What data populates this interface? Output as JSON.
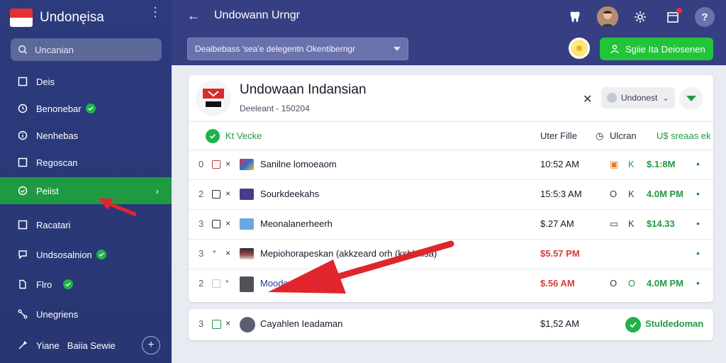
{
  "app": {
    "title": "Undonęisa"
  },
  "sidebar": {
    "search_placeholder": "Uncanian",
    "items": [
      {
        "label": "Deis",
        "icon": "square-icon",
        "badge": false
      },
      {
        "label": "Benonebar",
        "icon": "clock-icon",
        "badge": true
      },
      {
        "label": "Nenhebas",
        "icon": "info-icon",
        "badge": false
      },
      {
        "label": "Regoscan",
        "icon": "square-icon",
        "badge": false
      },
      {
        "label": "Peiist",
        "icon": "clock-icon",
        "badge": false,
        "active": true
      },
      {
        "label": "Racatari",
        "icon": "square-icon",
        "badge": false
      },
      {
        "label": "Undsosalnion",
        "icon": "chat-icon",
        "badge": true
      },
      {
        "label": "Flro",
        "icon": "file-icon",
        "badge": true
      },
      {
        "label": "Unegriens",
        "icon": "branch-icon",
        "badge": false
      },
      {
        "label": "Yiane",
        "label_suffix": "Baiia Sewie",
        "icon": "tool-icon",
        "badge": false
      }
    ]
  },
  "topbar": {
    "title": "Undowann Urngr",
    "filter_label": "Deaibebass 'sea'e delegentn Okentiberngr",
    "primary_button": "Sgiie Ita Deiosenen"
  },
  "card": {
    "title": "Undowaan Indansian",
    "subtitle": "Deeleant - 150204",
    "select_value": "Undonest",
    "header": {
      "label": "Kt Vecke",
      "col_file": "Uter Fille",
      "col_status": "Ulcran",
      "col_amount": "U$ sreaas ek"
    },
    "rows": [
      {
        "num": "0",
        "name": "Sanilne lomoeaom",
        "time": "10:52 AM",
        "time_alert": false,
        "a1": "lock-icon",
        "a2": "K",
        "amount": "$.1:8M",
        "thumb_color": "#3a5ba8"
      },
      {
        "num": "2",
        "name": "Sourkdeekahs",
        "time": "15:5:3 AM",
        "time_alert": false,
        "a1": "O",
        "a2": "K",
        "amount": "4.0M PM",
        "thumb_color": "#4a3a8c"
      },
      {
        "num": "3",
        "name": "Meonalanerheerh",
        "time": "$.27 AM",
        "time_alert": false,
        "a1": "calendar-icon",
        "a2": "K",
        "amount": "$14.33",
        "thumb_color": "#6aa7e0"
      },
      {
        "num": "3",
        "name": "Mepiohorapeskan (akkzeard orh (kshlmisa)",
        "time": "$5.57 PM",
        "time_alert": true,
        "a1": "",
        "a2": "",
        "amount": "",
        "thumb_color": "#6a3f3f"
      },
      {
        "num": "2",
        "name": "Moodomena",
        "time": "$.56 AM",
        "time_alert": true,
        "a1": "O",
        "a2": "O",
        "amount": "4.0M PM",
        "thumb_color": "#505258"
      }
    ]
  },
  "footer_row": {
    "num": "3",
    "name": "Cayahlen Ieadaman",
    "time": "$1,52 AM",
    "status": "Stuldedoman"
  },
  "colors": {
    "sidebar_bg": "#2c3b7d",
    "topbar_bg": "#373f83",
    "accent_green": "#1f9a43",
    "alert_red": "#d93b3b"
  }
}
